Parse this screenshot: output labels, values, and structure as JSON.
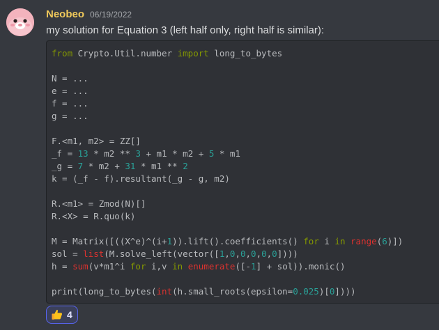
{
  "message": {
    "username": "Neobeo",
    "timestamp": "06/19/2022",
    "text": "my solution for Equation 3 (left half only, right half is similar):",
    "avatar_icon": "pink-blob-face-icon",
    "username_color": "#f0c95b"
  },
  "code": {
    "language": "python",
    "lines": [
      [
        [
          "keyword",
          "from"
        ],
        [
          "plain",
          " Crypto.Util.number "
        ],
        [
          "keyword",
          "import"
        ],
        [
          "plain",
          " long_to_bytes"
        ]
      ],
      [],
      [
        [
          "plain",
          "N = ..."
        ]
      ],
      [
        [
          "plain",
          "e = ..."
        ]
      ],
      [
        [
          "plain",
          "f = ..."
        ]
      ],
      [
        [
          "plain",
          "g = ..."
        ]
      ],
      [],
      [
        [
          "plain",
          "F.<m1, m2> = ZZ[]"
        ]
      ],
      [
        [
          "plain",
          "_f = "
        ],
        [
          "number",
          "13"
        ],
        [
          "plain",
          " * m2 ** "
        ],
        [
          "number",
          "3"
        ],
        [
          "plain",
          " + m1 * m2 + "
        ],
        [
          "number",
          "5"
        ],
        [
          "plain",
          " * m1"
        ]
      ],
      [
        [
          "plain",
          "_g = "
        ],
        [
          "number",
          "7"
        ],
        [
          "plain",
          " * m2 + "
        ],
        [
          "number",
          "31"
        ],
        [
          "plain",
          " * m1 ** "
        ],
        [
          "number",
          "2"
        ]
      ],
      [
        [
          "plain",
          "k = (_f - f).resultant(_g - g, m2)"
        ]
      ],
      [],
      [
        [
          "plain",
          "R.<m1> = Zmod(N)[]"
        ]
      ],
      [
        [
          "plain",
          "R.<X> = R.quo(k)"
        ]
      ],
      [],
      [
        [
          "plain",
          "M = Matrix([((X^e)^(i+"
        ],
        [
          "number",
          "1"
        ],
        [
          "plain",
          ")).lift().coefficients() "
        ],
        [
          "keyword",
          "for"
        ],
        [
          "plain",
          " i "
        ],
        [
          "keyword",
          "in"
        ],
        [
          "plain",
          " "
        ],
        [
          "builtin",
          "range"
        ],
        [
          "plain",
          "("
        ],
        [
          "number",
          "6"
        ],
        [
          "plain",
          ")])"
        ]
      ],
      [
        [
          "plain",
          "sol = "
        ],
        [
          "builtin",
          "list"
        ],
        [
          "plain",
          "(M.solve_left(vector(["
        ],
        [
          "number",
          "1"
        ],
        [
          "plain",
          ","
        ],
        [
          "number",
          "0"
        ],
        [
          "plain",
          ","
        ],
        [
          "number",
          "0"
        ],
        [
          "plain",
          ","
        ],
        [
          "number",
          "0"
        ],
        [
          "plain",
          ","
        ],
        [
          "number",
          "0"
        ],
        [
          "plain",
          ","
        ],
        [
          "number",
          "0"
        ],
        [
          "plain",
          "])))"
        ]
      ],
      [
        [
          "plain",
          "h = "
        ],
        [
          "builtin",
          "sum"
        ],
        [
          "plain",
          "(v*m1^i "
        ],
        [
          "keyword",
          "for"
        ],
        [
          "plain",
          " i,v "
        ],
        [
          "keyword",
          "in"
        ],
        [
          "plain",
          " "
        ],
        [
          "builtin",
          "enumerate"
        ],
        [
          "plain",
          "([-"
        ],
        [
          "number",
          "1"
        ],
        [
          "plain",
          "] + sol)).monic()"
        ]
      ],
      [],
      [
        [
          "plain",
          "print(long_to_bytes("
        ],
        [
          "builtin",
          "int"
        ],
        [
          "plain",
          "(h.small_roots(epsilon="
        ],
        [
          "number",
          "0.025"
        ],
        [
          "plain",
          ")["
        ],
        [
          "number",
          "0"
        ],
        [
          "plain",
          "])))"
        ]
      ]
    ]
  },
  "reaction": {
    "emoji": "thumbs-up-icon",
    "count": "4",
    "border_color": "#5865f2"
  },
  "colors": {
    "background": "#36393f",
    "codeblock_bg": "#2f3136",
    "keyword": "#859900",
    "number": "#2aa198",
    "builtin": "#dc322f"
  }
}
